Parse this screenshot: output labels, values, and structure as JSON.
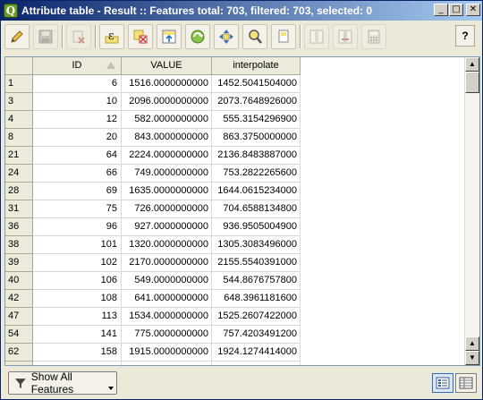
{
  "window": {
    "title": "Attribute table - Result :: Features total: 703, filtered: 703, selected: 0",
    "app_icon": "Q",
    "min_label": "_",
    "max_label": "□",
    "close_label": "✕"
  },
  "toolbar": {
    "buttons": [
      {
        "name": "toggle-editing-icon",
        "enabled": true
      },
      {
        "name": "save-edits-icon",
        "enabled": false
      },
      {
        "name": "delete-selected-icon",
        "enabled": false
      },
      {
        "name": "expression-select-icon",
        "enabled": true
      },
      {
        "name": "unselect-all-icon",
        "enabled": true
      },
      {
        "name": "move-selection-top-icon",
        "enabled": true
      },
      {
        "name": "invert-selection-icon",
        "enabled": true
      },
      {
        "name": "pan-to-selected-icon",
        "enabled": true
      },
      {
        "name": "zoom-to-selected-icon",
        "enabled": true
      },
      {
        "name": "copy-selected-icon",
        "enabled": true
      },
      {
        "name": "new-column-icon",
        "enabled": false
      },
      {
        "name": "delete-column-icon",
        "enabled": false
      },
      {
        "name": "field-calculator-icon",
        "enabled": false
      }
    ],
    "help_label": "?"
  },
  "table": {
    "columns": [
      "ID",
      "VALUE",
      "interpolate"
    ],
    "rows": [
      {
        "row": "1",
        "id": "6",
        "value": "1516.0000000000",
        "interpolate": "1452.5041504000"
      },
      {
        "row": "3",
        "id": "10",
        "value": "2096.0000000000",
        "interpolate": "2073.7648926000"
      },
      {
        "row": "4",
        "id": "12",
        "value": "582.0000000000",
        "interpolate": "555.3154296900"
      },
      {
        "row": "8",
        "id": "20",
        "value": "843.0000000000",
        "interpolate": "863.3750000000"
      },
      {
        "row": "21",
        "id": "64",
        "value": "2224.0000000000",
        "interpolate": "2136.8483887000"
      },
      {
        "row": "24",
        "id": "66",
        "value": "749.0000000000",
        "interpolate": "753.2822265600"
      },
      {
        "row": "28",
        "id": "69",
        "value": "1635.0000000000",
        "interpolate": "1644.0615234000"
      },
      {
        "row": "31",
        "id": "75",
        "value": "726.0000000000",
        "interpolate": "704.6588134800"
      },
      {
        "row": "36",
        "id": "96",
        "value": "927.0000000000",
        "interpolate": "936.9505004900"
      },
      {
        "row": "38",
        "id": "101",
        "value": "1320.0000000000",
        "interpolate": "1305.3083496000"
      },
      {
        "row": "39",
        "id": "102",
        "value": "2170.0000000000",
        "interpolate": "2155.5540391000"
      },
      {
        "row": "40",
        "id": "106",
        "value": "549.0000000000",
        "interpolate": "544.8676757800"
      },
      {
        "row": "42",
        "id": "108",
        "value": "641.0000000000",
        "interpolate": "648.3961181600"
      },
      {
        "row": "47",
        "id": "113",
        "value": "1534.0000000000",
        "interpolate": "1525.2607422000"
      },
      {
        "row": "54",
        "id": "141",
        "value": "775.0000000000",
        "interpolate": "757.4203491200"
      },
      {
        "row": "62",
        "id": "158",
        "value": "1915.0000000000",
        "interpolate": "1924.1274414000"
      }
    ]
  },
  "bottombar": {
    "filter_label": "Show All Features"
  }
}
